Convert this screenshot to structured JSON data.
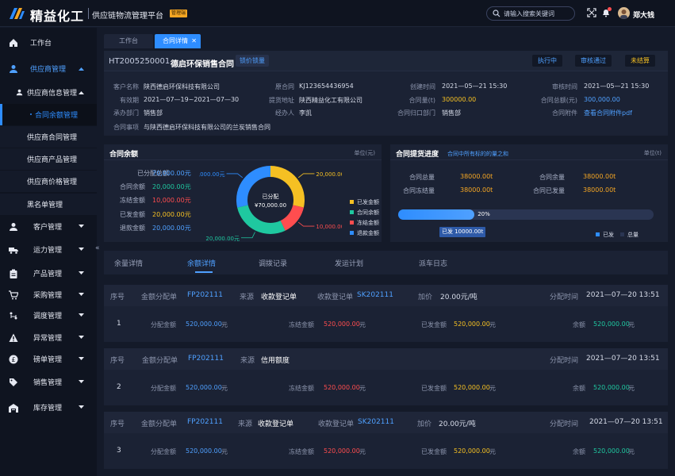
{
  "header": {
    "brand": "精益化工",
    "subtitle": "供应链物流管理平台",
    "badge": "管理端",
    "search_placeholder": "请输入搜索关键词",
    "user": "郑大钱"
  },
  "sidebar": {
    "items": [
      {
        "label": "工作台",
        "icon": "home-icon"
      },
      {
        "label": "供应商管理",
        "icon": "user-icon",
        "expanded": true
      },
      {
        "label": "供应商信息管理",
        "icon": "person-icon"
      },
      {
        "label": "合同余额管理",
        "active": true
      },
      {
        "label": "供应商合同管理"
      },
      {
        "label": "供应商产品管理"
      },
      {
        "label": "供应商价格管理"
      },
      {
        "label": "黑名单管理"
      },
      {
        "label": "客户管理",
        "icon": "person-icon"
      },
      {
        "label": "运力管理",
        "icon": "truck-icon"
      },
      {
        "label": "产品管理",
        "icon": "clipboard-icon"
      },
      {
        "label": "采购管理",
        "icon": "cart-icon"
      },
      {
        "label": "调度管理",
        "icon": "dispatch-icon"
      },
      {
        "label": "异常管理",
        "icon": "warning-icon"
      },
      {
        "label": "磅单管理",
        "icon": "coin-icon"
      },
      {
        "label": "销售管理",
        "icon": "tag-icon"
      },
      {
        "label": "库存管理",
        "icon": "warehouse-icon"
      }
    ],
    "collapse": "«"
  },
  "tabs": [
    {
      "label": "工作台"
    },
    {
      "label": "合同详情",
      "close": "✕"
    }
  ],
  "contract": {
    "no": "HT2005250001",
    "name": "德启环保销售合同",
    "lock_btn": "锁价锁量",
    "status_btns": [
      "执行中",
      "审核通过",
      "未结算"
    ],
    "fields": [
      {
        "k": "客户名称",
        "v": "陕西德启环保科技有限公司"
      },
      {
        "k": "有效期",
        "v": "2021—07—19~2021—07—30"
      },
      {
        "k": "承办部门",
        "v": "销售部"
      },
      {
        "k": "合同事项",
        "v": "与陕西德启环保科技有限公司的兰炭销售合同"
      },
      {
        "k": "原合同",
        "v": "KJ123654436954"
      },
      {
        "k": "提货地址",
        "v": "陕西精益化工有限公司"
      },
      {
        "k": "经办人",
        "v": "李凯"
      },
      {
        "k": "创建时间",
        "v": "2021—05—21 15:30"
      },
      {
        "k": "合同量(t)",
        "v": "300000.00"
      },
      {
        "k": "合同归口部门",
        "v": "销售部"
      },
      {
        "k": "审核时间",
        "v": "2021—05—21 15:30"
      },
      {
        "k": "合同总额(元)",
        "v": "300,000.00"
      },
      {
        "k": "合同附件",
        "v": "查看合同附件pdf"
      }
    ]
  },
  "balance": {
    "title": "合同余额",
    "unit": "单位(元)",
    "rows": [
      {
        "k": "已分配总额",
        "v": "70,000.00元",
        "color": "#4fa0ff"
      },
      {
        "k": "合同余额",
        "v": "20,000.00元",
        "color": "#1fc8a0"
      },
      {
        "k": "冻结金额",
        "v": "10,000.00元",
        "color": "#ff4d4f"
      },
      {
        "k": "已发金额",
        "v": "20,000.00元",
        "color": "#f5c023"
      },
      {
        "k": "退款金额",
        "v": "20,000.00元",
        "color": "#4fa0ff"
      }
    ],
    "donut": {
      "center_label": "已分配",
      "center_value": "¥70,000.00",
      "slices": [
        {
          "name": "已发金额",
          "value": 20000,
          "color": "#f5c023",
          "label": "20,000.00元"
        },
        {
          "name": "冻结金额",
          "value": 10000,
          "color": "#ff4d4f",
          "label": "10,000.00元"
        },
        {
          "name": "合同余额",
          "value": 20000,
          "color": "#1fc8a0",
          "label": "20,000.00元"
        },
        {
          "name": "退款金额",
          "value": 20000,
          "color": "#2e8dff",
          "label": "20,000.00元"
        }
      ]
    },
    "legend": [
      {
        "name": "已发金额",
        "color": "#f5c023"
      },
      {
        "name": "合同余额",
        "color": "#1fc8a0"
      },
      {
        "name": "冻结金额",
        "color": "#ff4d4f"
      },
      {
        "name": "退款金额",
        "color": "#2e8dff"
      }
    ]
  },
  "progress": {
    "title": "合同提货进度",
    "subtitle": "合同中所有标的的量之和",
    "unit": "单位(t)",
    "rows": [
      {
        "k": "合同总量",
        "v": "38000.00t"
      },
      {
        "k": "合同冻结量",
        "v": "38000.00t"
      },
      {
        "k": "合同余量",
        "v": "38000.00t"
      },
      {
        "k": "合同已发量",
        "v": "38000.00t"
      }
    ],
    "percent_label": "20%",
    "fill_fraction": 0.2,
    "tooltip": "已发 10000.00t",
    "legend": [
      "已发",
      "总量"
    ]
  },
  "subtabs": {
    "items": [
      "余量详情",
      "余额详情",
      "调拨记录",
      "发运计划",
      "派车日志"
    ],
    "active": 1
  },
  "records": [
    {
      "no_label": "序号",
      "no": "1",
      "bill_label": "金额分配单",
      "bill": "FP202111",
      "src_label": "来源",
      "src": "收款登记单",
      "reg_label": "收款登记单",
      "reg": "SK202111",
      "price_label": "加价",
      "price": "20.00元/吨",
      "time_label": "分配时间",
      "time": "2021—07—20  13:51",
      "alloc_label": "分配金额",
      "alloc": "520,000.00",
      "frozen_label": "冻结金额",
      "frozen": "520,000.00",
      "sent_label": "已发金额",
      "sent": "520,000.00",
      "bal_label": "余额",
      "bal": "520,000.00",
      "unit": "元"
    },
    {
      "no_label": "序号",
      "no": "2",
      "bill_label": "金额分配单",
      "bill": "FP202111",
      "src_label": "来源",
      "src": "信用额度",
      "time_label": "分配时间",
      "time": "2021—07—20  13:51",
      "alloc_label": "分配金额",
      "alloc": "520,000.00",
      "frozen_label": "冻结金额",
      "frozen": "520,000.00",
      "sent_label": "已发金额",
      "sent": "520,000.00",
      "bal_label": "余额",
      "bal": "520,000.00",
      "unit": "元"
    },
    {
      "no_label": "序号",
      "no": "3",
      "bill_label": "金额分配单",
      "bill": "FP202111",
      "src_label": "来源",
      "src": "收款登记单",
      "reg_label": "收款登记单",
      "reg": "SK202111",
      "price_label": "加价",
      "price": "20.00元/吨",
      "time_label": "分配时间",
      "time": "2021—07—20  13:51",
      "alloc_label": "分配金额",
      "alloc": "520,000.00",
      "frozen_label": "冻结金额",
      "frozen": "520,000.00",
      "sent_label": "已发金额",
      "sent": "520,000.00",
      "bal_label": "余额",
      "bal": "520,000.00",
      "unit": "元"
    }
  ]
}
